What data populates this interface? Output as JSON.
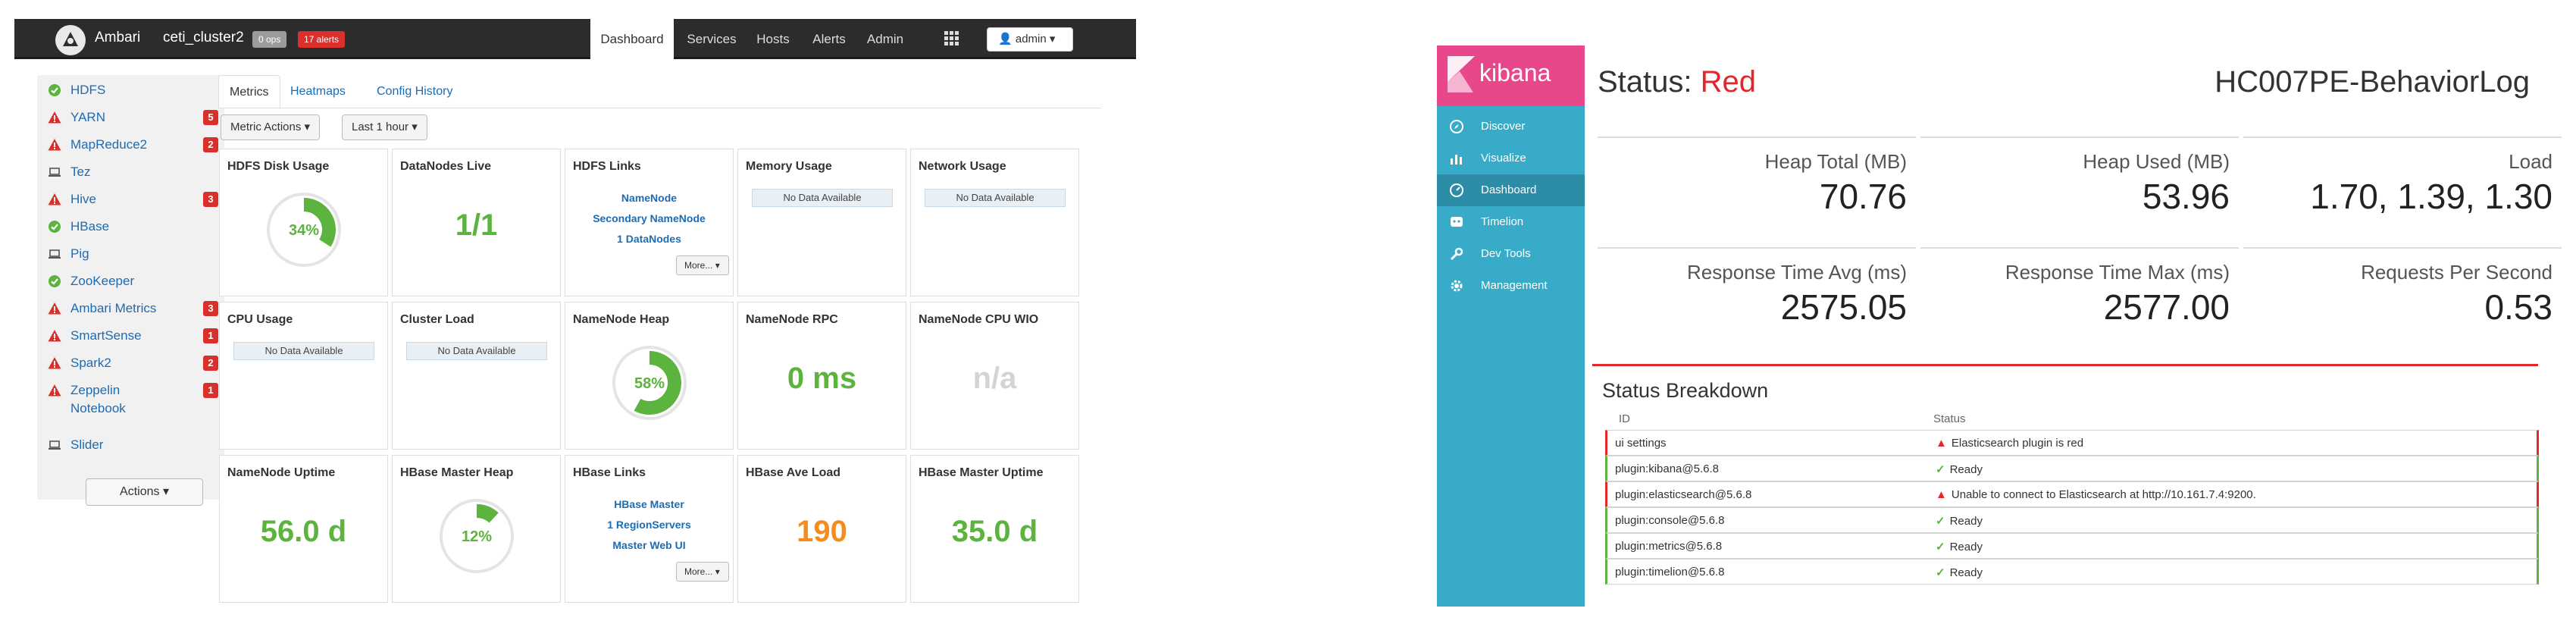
{
  "ambari": {
    "brand": "Ambari",
    "cluster": "ceti_cluster2",
    "ops_badge": "0 ops",
    "alerts_badge": "17 alerts",
    "nav": [
      "Dashboard",
      "Services",
      "Hosts",
      "Alerts",
      "Admin"
    ],
    "admin_label": "admin",
    "services": [
      {
        "name": "HDFS",
        "status": "ok",
        "count": ""
      },
      {
        "name": "YARN",
        "status": "alert",
        "count": "5"
      },
      {
        "name": "MapReduce2",
        "status": "alert",
        "count": "2"
      },
      {
        "name": "Tez",
        "status": "client",
        "count": ""
      },
      {
        "name": "Hive",
        "status": "alert",
        "count": "3"
      },
      {
        "name": "HBase",
        "status": "ok",
        "count": ""
      },
      {
        "name": "Pig",
        "status": "client",
        "count": ""
      },
      {
        "name": "ZooKeeper",
        "status": "ok",
        "count": ""
      },
      {
        "name": "Ambari Metrics",
        "status": "alert",
        "count": "3"
      },
      {
        "name": "SmartSense",
        "status": "alert",
        "count": "1"
      },
      {
        "name": "Spark2",
        "status": "alert",
        "count": "2"
      },
      {
        "name": "Zeppelin",
        "status": "alert",
        "count": "1",
        "second_line": "Notebook"
      },
      {
        "name": "Slider",
        "status": "client",
        "count": ""
      }
    ],
    "actions_label": "Actions",
    "tabs": [
      "Metrics",
      "Heatmaps",
      "Config History"
    ],
    "metric_actions_label": "Metric Actions",
    "time_range_label": "Last 1 hour",
    "widgets": {
      "hdfs_disk": {
        "title": "HDFS Disk Usage",
        "value": "34%",
        "fraction": 0.34
      },
      "datanodes": {
        "title": "DataNodes Live",
        "value": "1/1"
      },
      "hdfs_links": {
        "title": "HDFS Links",
        "links": [
          "NameNode",
          "Secondary NameNode",
          "1 DataNodes"
        ],
        "more": "More..."
      },
      "memory": {
        "title": "Memory Usage",
        "na": "No Data Available"
      },
      "network": {
        "title": "Network Usage",
        "na": "No Data Available"
      },
      "cpu": {
        "title": "CPU Usage",
        "na": "No Data Available"
      },
      "cluster_load": {
        "title": "Cluster Load",
        "na": "No Data Available"
      },
      "nn_heap": {
        "title": "NameNode Heap",
        "value": "58%",
        "fraction": 0.58
      },
      "nn_rpc": {
        "title": "NameNode RPC",
        "value": "0 ms"
      },
      "nn_cpu": {
        "title": "NameNode CPU WIO",
        "value": "n/a"
      },
      "nn_uptime": {
        "title": "NameNode Uptime",
        "value": "56.0 d"
      },
      "hbase_heap": {
        "title": "HBase Master Heap",
        "value": "12%",
        "fraction": 0.12
      },
      "hbase_links": {
        "title": "HBase Links",
        "links": [
          "HBase Master",
          "1 RegionServers",
          "Master Web UI"
        ],
        "more": "More..."
      },
      "hbase_load": {
        "title": "HBase Ave Load",
        "value": "190"
      },
      "hbase_uptime": {
        "title": "HBase Master Uptime",
        "value": "35.0 d"
      }
    }
  },
  "kibana": {
    "brand": "kibana",
    "nav": [
      "Discover",
      "Visualize",
      "Dashboard",
      "Timelion",
      "Dev Tools",
      "Management"
    ],
    "status_label": "Status:",
    "status_value": "Red",
    "instance_name": "HC007PE-BehaviorLog",
    "metrics": [
      {
        "label": "Heap Total (MB)",
        "value": "70.76"
      },
      {
        "label": "Heap Used (MB)",
        "value": "53.96"
      },
      {
        "label": "Load",
        "value": "1.70, 1.39, 1.30"
      },
      {
        "label": "Response Time Avg (ms)",
        "value": "2575.05"
      },
      {
        "label": "Response Time Max (ms)",
        "value": "2577.00"
      },
      {
        "label": "Requests Per Second",
        "value": "0.53"
      }
    ],
    "breakdown_title": "Status Breakdown",
    "col_id": "ID",
    "col_status": "Status",
    "rows": [
      {
        "id": "ui settings",
        "status": "Elasticsearch plugin is red",
        "state": "red"
      },
      {
        "id": "plugin:kibana@5.6.8",
        "status": "Ready",
        "state": "green"
      },
      {
        "id": "plugin:elasticsearch@5.6.8",
        "status": "Unable to connect to Elasticsearch at http://10.161.7.4:9200.",
        "state": "red"
      },
      {
        "id": "plugin:console@5.6.8",
        "status": "Ready",
        "state": "green"
      },
      {
        "id": "plugin:metrics@5.6.8",
        "status": "Ready",
        "state": "green"
      },
      {
        "id": "plugin:timelion@5.6.8",
        "status": "Ready",
        "state": "green"
      }
    ],
    "colors": {
      "sidebar": "#37abc8",
      "logo": "#e8488b",
      "error": "#e3272a",
      "ok": "#5cb33e"
    }
  }
}
